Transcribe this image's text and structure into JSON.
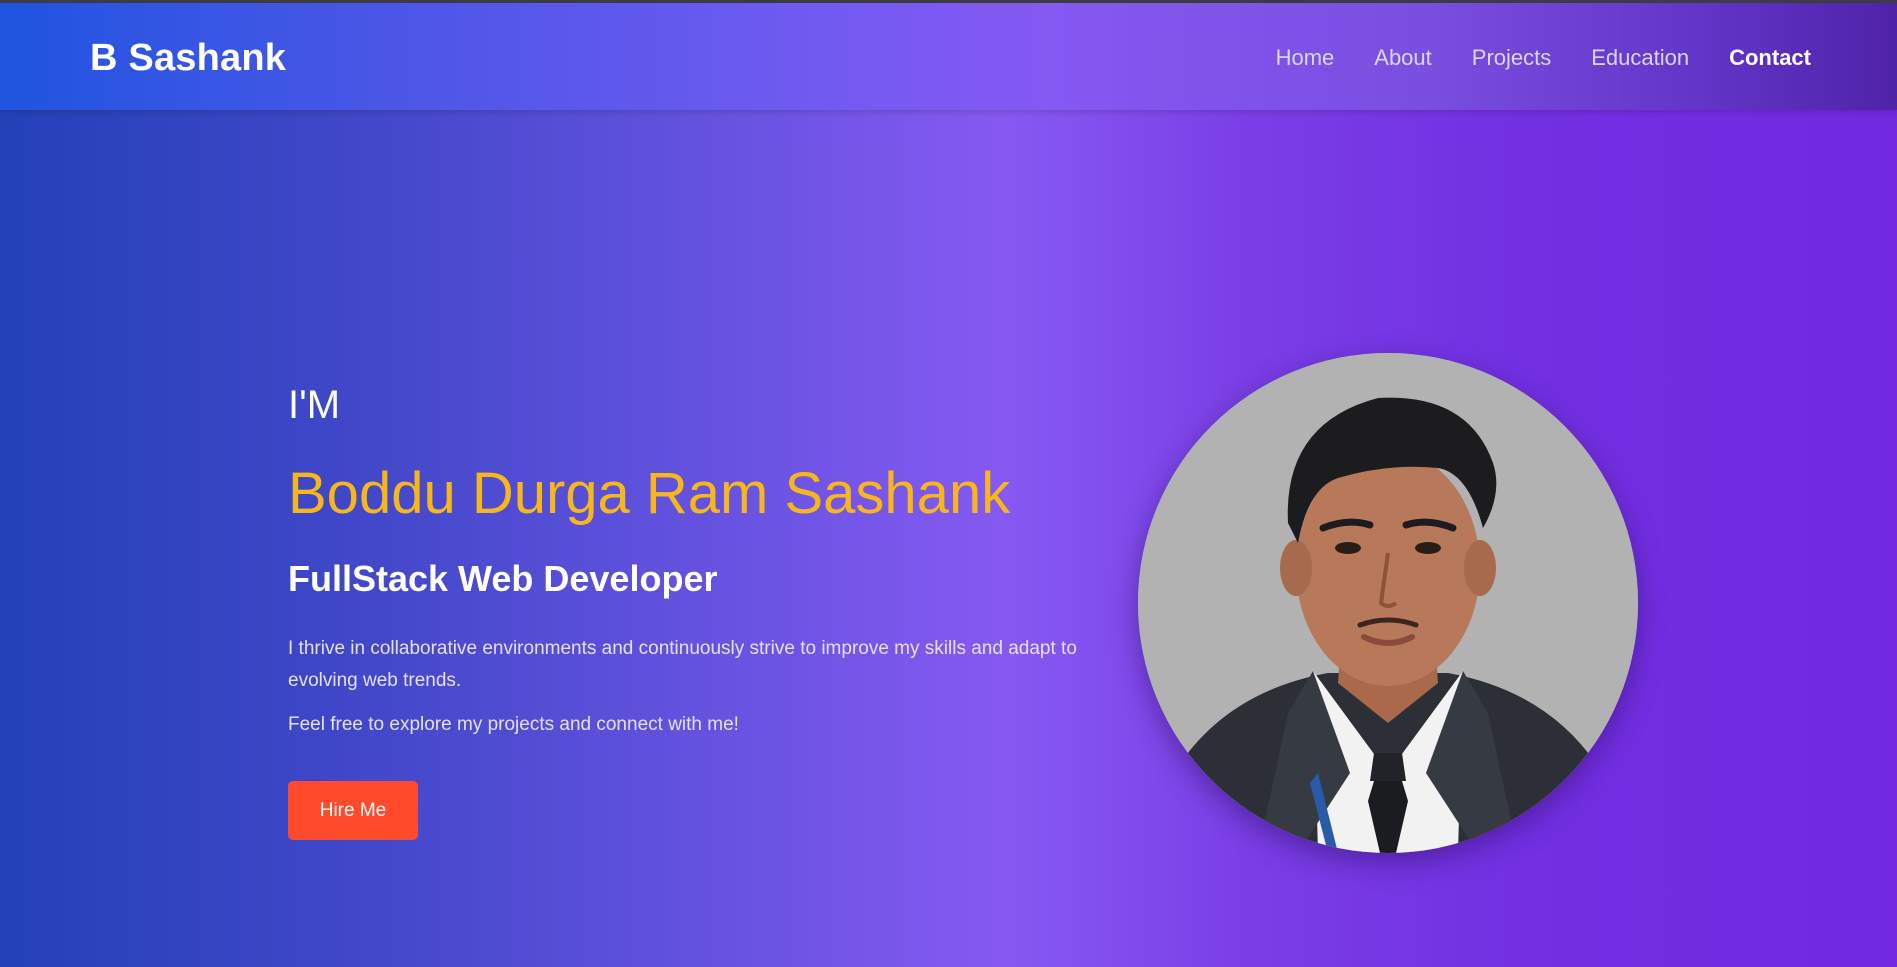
{
  "brand": "B Sashank",
  "nav": {
    "items": [
      {
        "label": "Home"
      },
      {
        "label": "About"
      },
      {
        "label": "Projects"
      },
      {
        "label": "Education"
      },
      {
        "label": "Contact"
      }
    ]
  },
  "hero": {
    "intro": "I'M",
    "name": "Boddu Durga Ram Sashank",
    "role": "FullStack Web Developer",
    "description": "I thrive in collaborative environments and continuously strive to improve my skills and adapt to evolving web trends.",
    "cta_text": "Feel free to explore my projects and connect with me!",
    "hire_button": "Hire Me"
  },
  "colors": {
    "accent_name": "#f7b71b",
    "hire_button_bg": "#ff4a2b"
  }
}
